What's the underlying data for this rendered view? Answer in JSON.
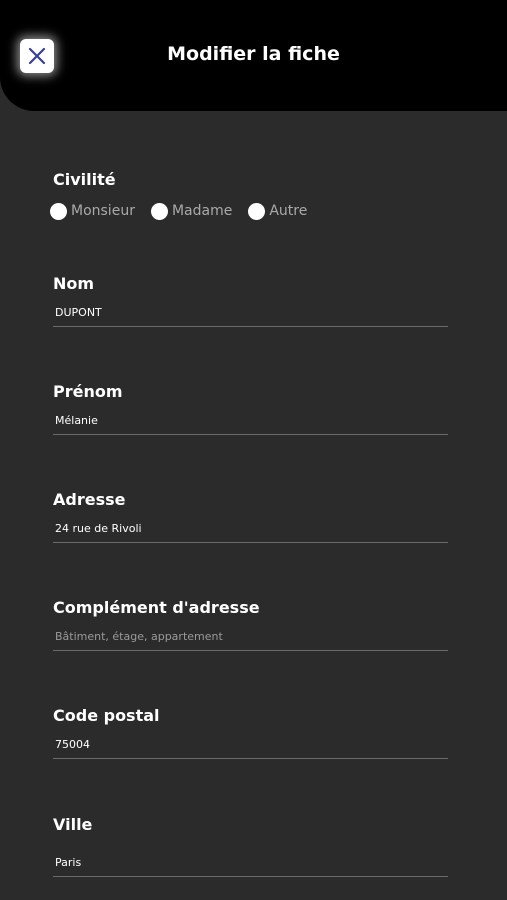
{
  "header": {
    "title": "Modifier la fiche",
    "close_icon": "close-icon",
    "accent_color": "#3b3f8f"
  },
  "form": {
    "civilite": {
      "label": "Civilité",
      "options": [
        "Monsieur",
        "Madame",
        "Autre"
      ]
    },
    "nom": {
      "label": "Nom",
      "value": "DUPONT",
      "placeholder": ""
    },
    "prenom": {
      "label": "Prénom",
      "value": "Mélanie",
      "placeholder": ""
    },
    "adresse": {
      "label": "Adresse",
      "value": "24 rue de Rivoli",
      "placeholder": ""
    },
    "complement": {
      "label": "Complément d'adresse",
      "value": "",
      "placeholder": "Bâtiment, étage, appartement"
    },
    "code_postal": {
      "label": "Code postal",
      "value": "75004",
      "placeholder": ""
    },
    "ville": {
      "label": "Ville",
      "value": "Paris",
      "placeholder": ""
    }
  }
}
